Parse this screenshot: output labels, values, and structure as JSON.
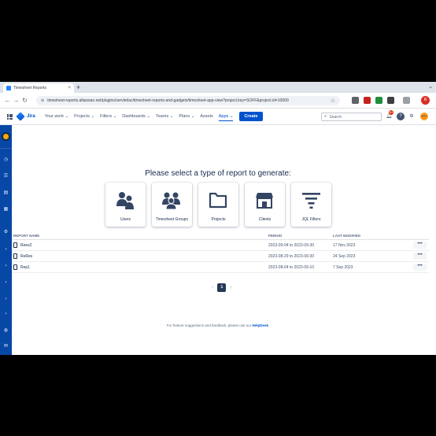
{
  "browser": {
    "tab_title": "Timesheet Reports",
    "tab_close": "×",
    "new_tab": "+",
    "win_controls": "⌄",
    "url": "timesheet-reports.atlassian.net/plugins/servlet/ac/timesheet-reports-and-gadgets/timesheet-app-view?project.key=SOFF&project.id=10000",
    "profile_initial": "R"
  },
  "topnav": {
    "product": "Jira",
    "items": [
      "Your work ⌄",
      "Projects ⌄",
      "Filters ⌄",
      "Dashboards ⌄",
      "Teams ⌄",
      "Plans ⌄",
      "Assets",
      "Apps ⌄"
    ],
    "create_label": "Create",
    "search_placeholder": "Search",
    "notification_count": "9+",
    "avatar_initials": "KV"
  },
  "main": {
    "heading": "Please select a type of report to generate:",
    "cards": [
      {
        "label": "Users",
        "icon": "users-icon"
      },
      {
        "label": "Timesheet Groups",
        "icon": "groups-icon"
      },
      {
        "label": "Projects",
        "icon": "folder-icon"
      },
      {
        "label": "Clients",
        "icon": "store-icon"
      },
      {
        "label": "JQL Filters",
        "icon": "filter-icon"
      }
    ],
    "table": {
      "headers": {
        "name": "Report name",
        "period": "Period",
        "modified": "Last modified"
      },
      "rows": [
        {
          "name": "Rees2",
          "period": "2023-09-04 to 2023-09-30",
          "modified": "17 Nov 2023"
        },
        {
          "name": "ReRes",
          "period": "2023-08-29 to 2023-09-30",
          "modified": "24 Sep 2023"
        },
        {
          "name": "Rep1",
          "period": "2023-08-04 to 2023-09-10",
          "modified": "7 Sep 2023"
        }
      ],
      "more_label": "•••"
    },
    "pagination": {
      "current_page": "1",
      "prev": "‹",
      "next": "›"
    },
    "footer": {
      "text": "For feature suggestions and feedback, please use our ",
      "link": "HelpDesk",
      "end": "."
    }
  },
  "colors": {
    "sidebar": "#0747a6",
    "primary": "#0052cc",
    "card_icon": "#344563"
  }
}
